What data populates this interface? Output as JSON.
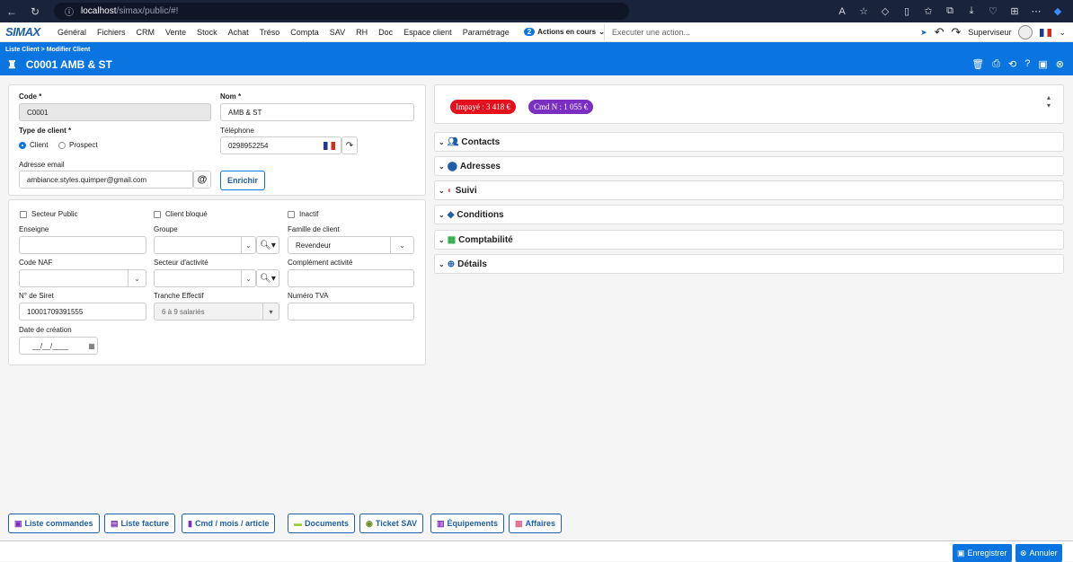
{
  "browser": {
    "url_host": "localhost",
    "url_path": "/simax/public/#!"
  },
  "app": {
    "logo": "SIMAX"
  },
  "menu": [
    "Général",
    "Fichiers",
    "CRM",
    "Vente",
    "Stock",
    "Achat",
    "Tréso",
    "Compta",
    "SAV",
    "RH",
    "Doc",
    "Espace client",
    "Paramétrage"
  ],
  "actions": {
    "count": "2",
    "label": "Actions en cours"
  },
  "exec_placeholder": "Executer une action...",
  "user": {
    "name": "Superviseur"
  },
  "header": {
    "breadcrumb": "Liste Client  >  Modifier Client",
    "title": "C0001 AMB & ST"
  },
  "form1": {
    "code_label": "Code *",
    "code_value": "C0001",
    "nom_label": "Nom *",
    "nom_value": "AMB & ST",
    "type_label": "Type de client *",
    "type_client": "Client",
    "type_prospect": "Prospect",
    "tel_label": "Téléphone",
    "tel_value": "0298952254",
    "email_label": "Adresse email",
    "email_value": "ambiance.styles.quimper@gmail.com",
    "enrich_label": "Enrichir"
  },
  "form2": {
    "secteur_public": "Secteur Public",
    "client_bloque": "Client bloqué",
    "inactif": "Inactif",
    "enseigne_label": "Enseigne",
    "groupe_label": "Groupe",
    "famille_label": "Famille de client",
    "famille_value": "Revendeur",
    "naf_label": "Code NAF",
    "secteur_label": "Secteur d'activité",
    "complement_label": "Complément activité",
    "siret_label": "N° de Siret",
    "siret_value": "10001709391555",
    "tranche_label": "Tranche Effectif",
    "tranche_value": "6 à 9 salariés",
    "tva_label": "Numéro TVA",
    "date_label": "Date de création",
    "date_value": "__/__/____"
  },
  "badges": {
    "impaye": "Impayé : 3 418 €",
    "cmd": "Cmd N : 1 055 €",
    "impaye_color": "#e3101d",
    "cmd_color": "#7a2fc0"
  },
  "sections": [
    "Contacts",
    "Adresses",
    "Suivi",
    "Conditions",
    "Comptabilité",
    "Détails"
  ],
  "bottom_buttons": [
    "Liste commandes",
    "Liste facture",
    "Cmd / mois / article",
    "Documents",
    "Ticket SAV",
    "Équipements",
    "Affaires"
  ],
  "footer": {
    "save": "Enregistrer",
    "cancel": "Annuler"
  }
}
